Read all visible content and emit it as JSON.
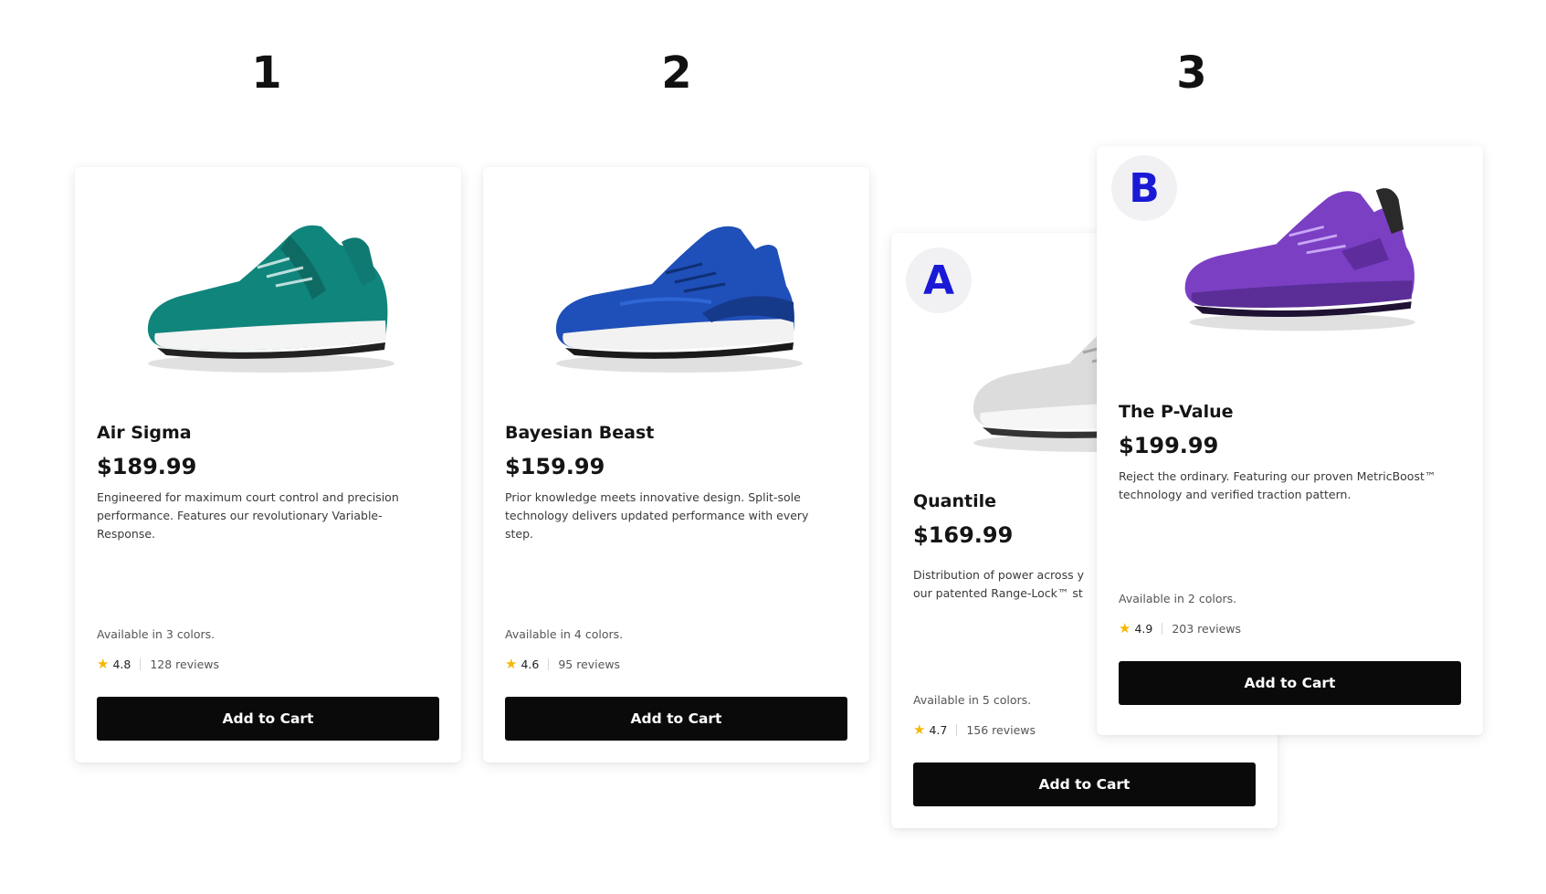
{
  "column_numbers": [
    "1",
    "2",
    "3"
  ],
  "badges": [
    "A",
    "B"
  ],
  "products": [
    {
      "name": "Air Sigma",
      "price": "$189.99",
      "description": "Engineered for maximum court control and precision performance. Features our revolutionary Variable-Response.",
      "colors": "Available in 3 colors.",
      "rating": "4.8",
      "reviews": "128 reviews",
      "button": "Add to Cart",
      "shoe_color": "#10857c",
      "image_icon": "teal-sneaker-icon"
    },
    {
      "name": "Bayesian Beast",
      "price": "$159.99",
      "description": "Prior knowledge meets innovative design. Split-sole technology delivers updated performance with every step.",
      "colors": "Available in 4 colors.",
      "rating": "4.6",
      "reviews": "95 reviews",
      "button": "Add to Cart",
      "shoe_color": "#1f4fb8",
      "image_icon": "blue-sneaker-icon"
    },
    {
      "name": "Quantile",
      "price": "$169.99",
      "description_visible": "Distribution of power across y",
      "description_line2_visible": "our patented Range-Lock™ st",
      "colors": "Available in 5 colors.",
      "rating": "4.7",
      "reviews": "156 reviews",
      "button": "Add to Cart",
      "shoe_color": "#d9d9d9",
      "image_icon": "white-sneaker-icon"
    },
    {
      "name": "The P-Value",
      "price": "$199.99",
      "description": "Reject the ordinary. Featuring our proven MetricBoost™ technology and verified traction pattern.",
      "colors": "Available in 2 colors.",
      "rating": "4.9",
      "reviews": "203 reviews",
      "button": "Add to Cart",
      "shoe_color": "#7b3fc4",
      "image_icon": "purple-sneaker-icon"
    }
  ],
  "colors": {
    "badge_text": "#1a1ad6",
    "star": "#f5b800",
    "button_bg": "#0a0a0a"
  }
}
